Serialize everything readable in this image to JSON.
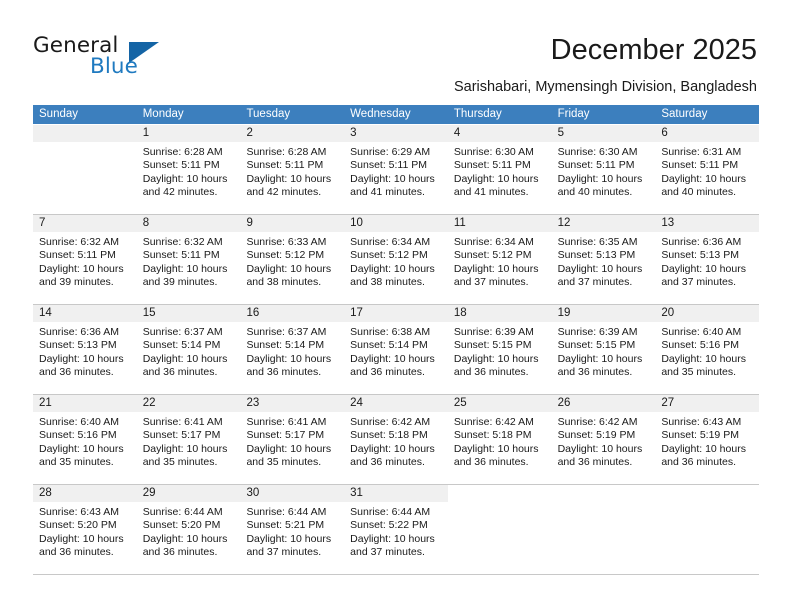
{
  "brand": {
    "line1": "General",
    "line2": "Blue",
    "triangle_color": "#1464a5",
    "blue_text_color": "#1f7ac0",
    "logo_icon": "triangle-icon"
  },
  "header": {
    "title": "December 2025",
    "subtitle": "Sarishabari, Mymensingh Division, Bangladesh"
  },
  "calendar": {
    "header_bg": "#3c7fbe",
    "day_number_bg": "#f0f0f0",
    "weekdays": [
      "Sunday",
      "Monday",
      "Tuesday",
      "Wednesday",
      "Thursday",
      "Friday",
      "Saturday"
    ],
    "weeks": [
      [
        {
          "day": "",
          "sunrise": "",
          "sunset": "",
          "daylight_line1": "",
          "daylight_line2": "",
          "empty": true
        },
        {
          "day": "1",
          "sunrise": "Sunrise: 6:28 AM",
          "sunset": "Sunset: 5:11 PM",
          "daylight_line1": "Daylight: 10 hours",
          "daylight_line2": "and 42 minutes."
        },
        {
          "day": "2",
          "sunrise": "Sunrise: 6:28 AM",
          "sunset": "Sunset: 5:11 PM",
          "daylight_line1": "Daylight: 10 hours",
          "daylight_line2": "and 42 minutes."
        },
        {
          "day": "3",
          "sunrise": "Sunrise: 6:29 AM",
          "sunset": "Sunset: 5:11 PM",
          "daylight_line1": "Daylight: 10 hours",
          "daylight_line2": "and 41 minutes."
        },
        {
          "day": "4",
          "sunrise": "Sunrise: 6:30 AM",
          "sunset": "Sunset: 5:11 PM",
          "daylight_line1": "Daylight: 10 hours",
          "daylight_line2": "and 41 minutes."
        },
        {
          "day": "5",
          "sunrise": "Sunrise: 6:30 AM",
          "sunset": "Sunset: 5:11 PM",
          "daylight_line1": "Daylight: 10 hours",
          "daylight_line2": "and 40 minutes."
        },
        {
          "day": "6",
          "sunrise": "Sunrise: 6:31 AM",
          "sunset": "Sunset: 5:11 PM",
          "daylight_line1": "Daylight: 10 hours",
          "daylight_line2": "and 40 minutes."
        }
      ],
      [
        {
          "day": "7",
          "sunrise": "Sunrise: 6:32 AM",
          "sunset": "Sunset: 5:11 PM",
          "daylight_line1": "Daylight: 10 hours",
          "daylight_line2": "and 39 minutes."
        },
        {
          "day": "8",
          "sunrise": "Sunrise: 6:32 AM",
          "sunset": "Sunset: 5:11 PM",
          "daylight_line1": "Daylight: 10 hours",
          "daylight_line2": "and 39 minutes."
        },
        {
          "day": "9",
          "sunrise": "Sunrise: 6:33 AM",
          "sunset": "Sunset: 5:12 PM",
          "daylight_line1": "Daylight: 10 hours",
          "daylight_line2": "and 38 minutes."
        },
        {
          "day": "10",
          "sunrise": "Sunrise: 6:34 AM",
          "sunset": "Sunset: 5:12 PM",
          "daylight_line1": "Daylight: 10 hours",
          "daylight_line2": "and 38 minutes."
        },
        {
          "day": "11",
          "sunrise": "Sunrise: 6:34 AM",
          "sunset": "Sunset: 5:12 PM",
          "daylight_line1": "Daylight: 10 hours",
          "daylight_line2": "and 37 minutes."
        },
        {
          "day": "12",
          "sunrise": "Sunrise: 6:35 AM",
          "sunset": "Sunset: 5:13 PM",
          "daylight_line1": "Daylight: 10 hours",
          "daylight_line2": "and 37 minutes."
        },
        {
          "day": "13",
          "sunrise": "Sunrise: 6:36 AM",
          "sunset": "Sunset: 5:13 PM",
          "daylight_line1": "Daylight: 10 hours",
          "daylight_line2": "and 37 minutes."
        }
      ],
      [
        {
          "day": "14",
          "sunrise": "Sunrise: 6:36 AM",
          "sunset": "Sunset: 5:13 PM",
          "daylight_line1": "Daylight: 10 hours",
          "daylight_line2": "and 36 minutes."
        },
        {
          "day": "15",
          "sunrise": "Sunrise: 6:37 AM",
          "sunset": "Sunset: 5:14 PM",
          "daylight_line1": "Daylight: 10 hours",
          "daylight_line2": "and 36 minutes."
        },
        {
          "day": "16",
          "sunrise": "Sunrise: 6:37 AM",
          "sunset": "Sunset: 5:14 PM",
          "daylight_line1": "Daylight: 10 hours",
          "daylight_line2": "and 36 minutes."
        },
        {
          "day": "17",
          "sunrise": "Sunrise: 6:38 AM",
          "sunset": "Sunset: 5:14 PM",
          "daylight_line1": "Daylight: 10 hours",
          "daylight_line2": "and 36 minutes."
        },
        {
          "day": "18",
          "sunrise": "Sunrise: 6:39 AM",
          "sunset": "Sunset: 5:15 PM",
          "daylight_line1": "Daylight: 10 hours",
          "daylight_line2": "and 36 minutes."
        },
        {
          "day": "19",
          "sunrise": "Sunrise: 6:39 AM",
          "sunset": "Sunset: 5:15 PM",
          "daylight_line1": "Daylight: 10 hours",
          "daylight_line2": "and 36 minutes."
        },
        {
          "day": "20",
          "sunrise": "Sunrise: 6:40 AM",
          "sunset": "Sunset: 5:16 PM",
          "daylight_line1": "Daylight: 10 hours",
          "daylight_line2": "and 35 minutes."
        }
      ],
      [
        {
          "day": "21",
          "sunrise": "Sunrise: 6:40 AM",
          "sunset": "Sunset: 5:16 PM",
          "daylight_line1": "Daylight: 10 hours",
          "daylight_line2": "and 35 minutes."
        },
        {
          "day": "22",
          "sunrise": "Sunrise: 6:41 AM",
          "sunset": "Sunset: 5:17 PM",
          "daylight_line1": "Daylight: 10 hours",
          "daylight_line2": "and 35 minutes."
        },
        {
          "day": "23",
          "sunrise": "Sunrise: 6:41 AM",
          "sunset": "Sunset: 5:17 PM",
          "daylight_line1": "Daylight: 10 hours",
          "daylight_line2": "and 35 minutes."
        },
        {
          "day": "24",
          "sunrise": "Sunrise: 6:42 AM",
          "sunset": "Sunset: 5:18 PM",
          "daylight_line1": "Daylight: 10 hours",
          "daylight_line2": "and 36 minutes."
        },
        {
          "day": "25",
          "sunrise": "Sunrise: 6:42 AM",
          "sunset": "Sunset: 5:18 PM",
          "daylight_line1": "Daylight: 10 hours",
          "daylight_line2": "and 36 minutes."
        },
        {
          "day": "26",
          "sunrise": "Sunrise: 6:42 AM",
          "sunset": "Sunset: 5:19 PM",
          "daylight_line1": "Daylight: 10 hours",
          "daylight_line2": "and 36 minutes."
        },
        {
          "day": "27",
          "sunrise": "Sunrise: 6:43 AM",
          "sunset": "Sunset: 5:19 PM",
          "daylight_line1": "Daylight: 10 hours",
          "daylight_line2": "and 36 minutes."
        }
      ],
      [
        {
          "day": "28",
          "sunrise": "Sunrise: 6:43 AM",
          "sunset": "Sunset: 5:20 PM",
          "daylight_line1": "Daylight: 10 hours",
          "daylight_line2": "and 36 minutes."
        },
        {
          "day": "29",
          "sunrise": "Sunrise: 6:44 AM",
          "sunset": "Sunset: 5:20 PM",
          "daylight_line1": "Daylight: 10 hours",
          "daylight_line2": "and 36 minutes."
        },
        {
          "day": "30",
          "sunrise": "Sunrise: 6:44 AM",
          "sunset": "Sunset: 5:21 PM",
          "daylight_line1": "Daylight: 10 hours",
          "daylight_line2": "and 37 minutes."
        },
        {
          "day": "31",
          "sunrise": "Sunrise: 6:44 AM",
          "sunset": "Sunset: 5:22 PM",
          "daylight_line1": "Daylight: 10 hours",
          "daylight_line2": "and 37 minutes."
        },
        {
          "day": "",
          "sunrise": "",
          "sunset": "",
          "daylight_line1": "",
          "daylight_line2": "",
          "blank": true
        },
        {
          "day": "",
          "sunrise": "",
          "sunset": "",
          "daylight_line1": "",
          "daylight_line2": "",
          "blank": true
        },
        {
          "day": "",
          "sunrise": "",
          "sunset": "",
          "daylight_line1": "",
          "daylight_line2": "",
          "blank": true
        }
      ]
    ]
  }
}
